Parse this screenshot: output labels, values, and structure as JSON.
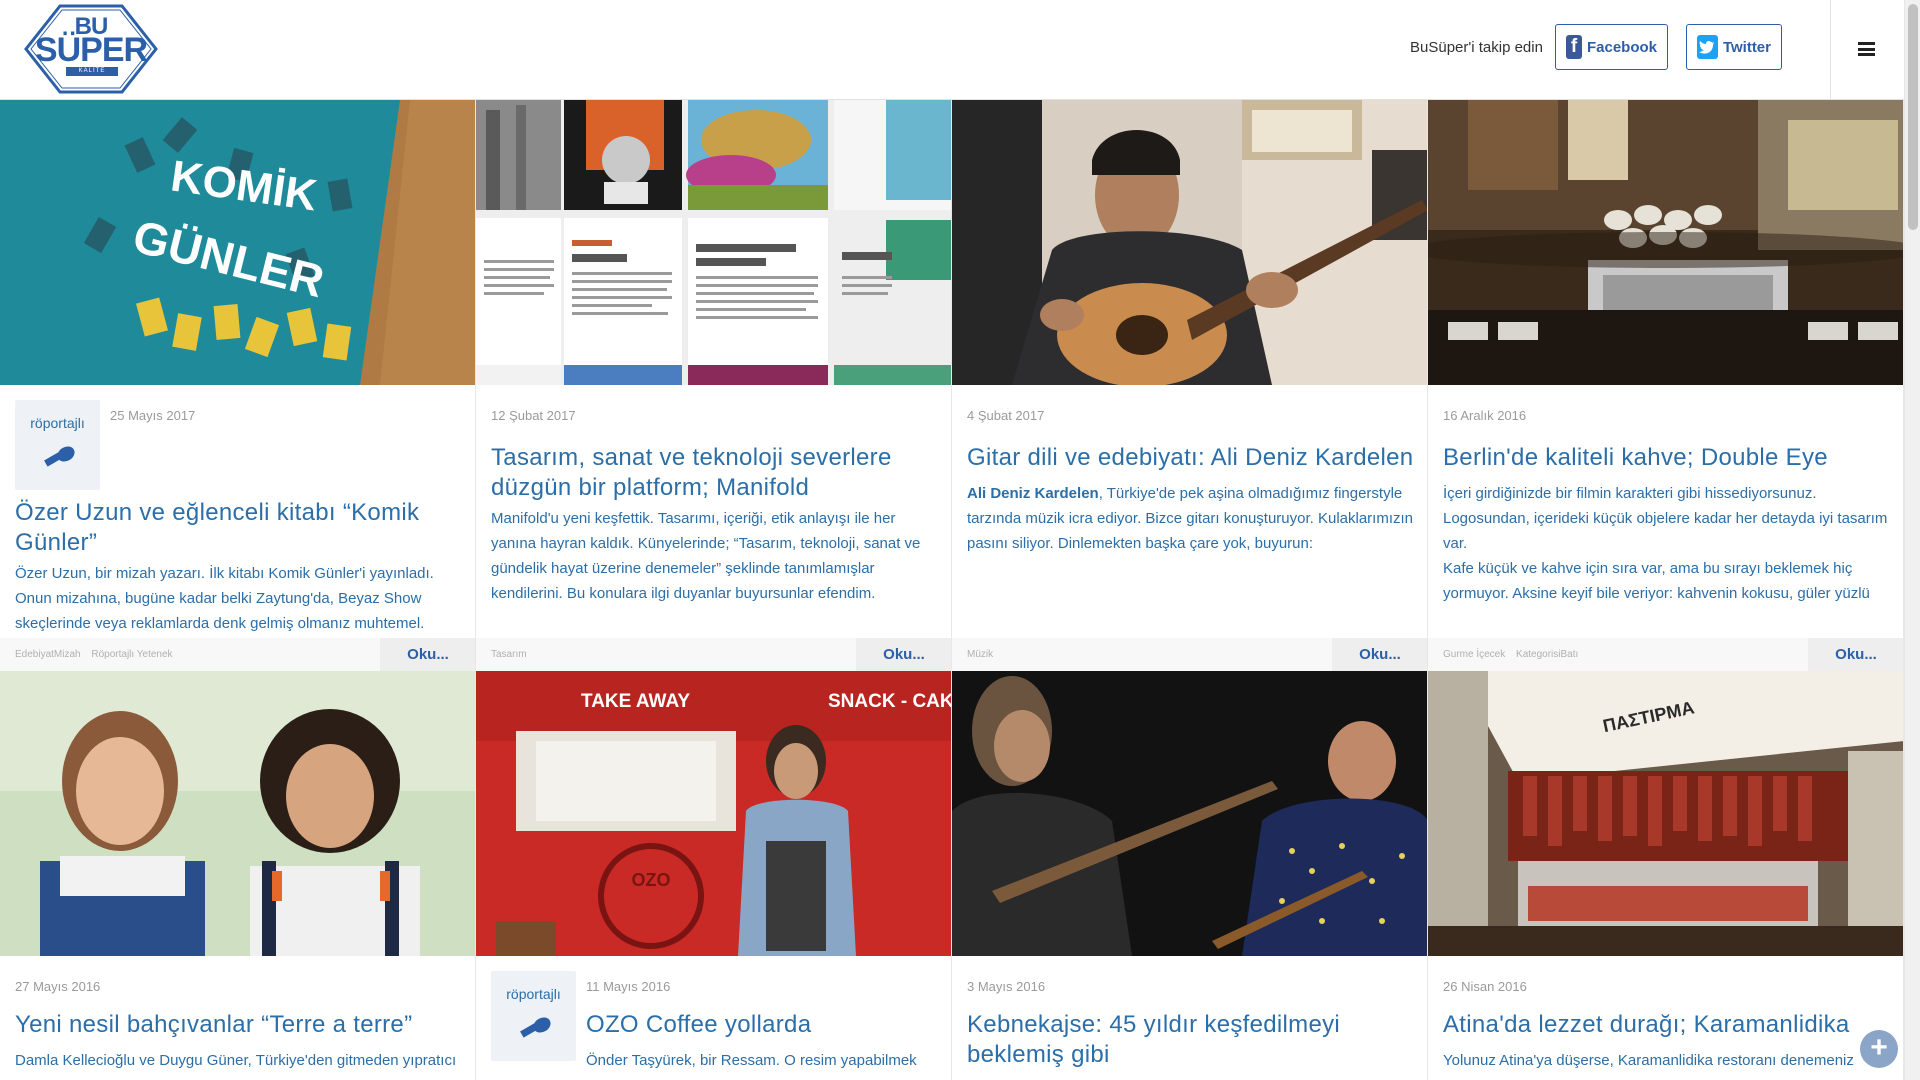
{
  "header": {
    "logo": {
      "bu": "BU",
      "super": "SÜPER",
      "sub": "KALİTE AVCISI"
    },
    "follow_text": "BuSüper'i takip edin",
    "facebook_label": "Facebook",
    "twitter_label": "Twitter"
  },
  "read_more_label": "Oku...",
  "badge_label": "röportajlı",
  "cards": [
    {
      "date": "25 Mayıs 2017",
      "title": "Özer Uzun ve eğlenceli kitabı “Komik Günler”",
      "excerpt": "Özer Uzun, bir mizah yazarı. İlk kitabı Komik Günler'i yayınladı. Onun mizahına, bugüne kadar belki  Zaytung'da, Beyaz Show skeçlerinde veya reklamlarda denk gelmiş olmanız muhtemel.",
      "tags": [
        "EdebiyatMizah",
        "Röportajlı Yetenek"
      ],
      "image_text": [
        "KOMİK",
        "GÜNLER"
      ]
    },
    {
      "date": "12 Şubat 2017",
      "title": "Tasarım, sanat ve teknoloji severlere düzgün bir platform; Manifold",
      "excerpt": "Manifold'u yeni keşfettik. Tasarımı, içeriği, etik anlayışı ile her yanına hayran kaldık. Künyelerinde; “Tasarım, teknoloji, sanat ve gündelik hayat üzerine denemeler” şeklinde tanımlamışlar kendilerini. Bu konulara ilgi duyanlar buyursunlar efendim.",
      "tags": [
        "Tasarım"
      ]
    },
    {
      "date": "4 Şubat 2017",
      "title": "Gitar dili ve edebiyatı: Ali Deniz Kardelen",
      "excerpt_bold": "Ali Deniz Kardelen",
      "excerpt": ", Türkiye'de pek aşina olmadığımız fingerstyle tarzında müzik icra ediyor. Bizce gitarı konuşturuyor. Kulaklarımızın pasını siliyor. Dinlemekten başka çare yok, buyurun:",
      "tags": [
        "Müzik"
      ]
    },
    {
      "date": "16 Aralık 2016",
      "title": "Berlin'de kaliteli kahve; Double Eye",
      "excerpt": "İçeri girdiğinizde bir filmin karakteri gibi hissediyorsunuz. Logosundan, içerideki küçük objelere kadar her detayda iyi tasarım var.",
      "excerpt2": "Kafe küçük ve kahve için sıra var, ama bu sırayı beklemek hiç yormuyor. Aksine keyif bile veriyor: kahvenin kokusu, güler yüzlü",
      "tags": [
        "Gurme İçecek",
        "KategorisiBatı"
      ]
    },
    {
      "date": "27 Mayıs 2016",
      "title": "Yeni nesil bahçıvanlar “Terre a terre”",
      "excerpt": "Damla Kellecioğlu ve Duygu Güner, Türkiye'den gitmeden yıpratıcı"
    },
    {
      "date": "11 Mayıs 2016",
      "title": "OZO Coffee yollarda",
      "excerpt": "Önder Taşyürek, bir Ressam. O resim yapabilmek",
      "image_text": [
        "TAKE AWAY",
        "SNACK - CAK",
        "OZO"
      ]
    },
    {
      "date": "3 Mayıs 2016",
      "title": "Kebnekajse: 45 yıldır keşfedilmeyi beklemiş gibi",
      "excerpt": ""
    },
    {
      "date": "26 Nisan 2016",
      "title": "Atina'da lezzet durağı; Karamanlidika",
      "excerpt": "Yolunuz Atina'ya düşerse, Karamanlidika restoranı denemeniz",
      "image_text": [
        "ΠΑΣΤΙΡΜΑ"
      ]
    }
  ],
  "colors": {
    "brand": "#2b5fa8",
    "link": "#2b6ea8",
    "facebook": "#3b5998",
    "twitter": "#1da1f2"
  },
  "icons": [
    "facebook-icon",
    "twitter-icon",
    "hamburger-icon",
    "microphone-icon",
    "plus-icon"
  ]
}
